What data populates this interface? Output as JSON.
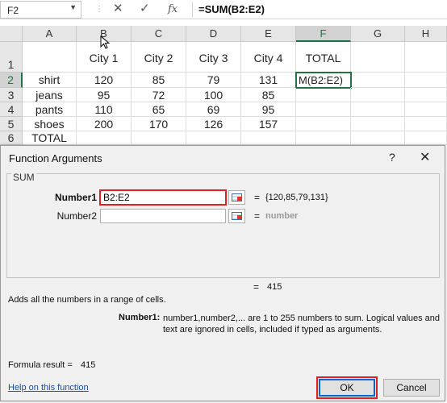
{
  "formula_bar": {
    "name_box": "F2",
    "formula": "=SUM(B2:E2)",
    "cancel_icon": "x-icon",
    "enter_icon": "check-icon",
    "fx_label": "fx"
  },
  "sheet": {
    "columns": [
      "A",
      "B",
      "C",
      "D",
      "E",
      "F",
      "G",
      "H"
    ],
    "rows": [
      "1",
      "2",
      "3",
      "4",
      "5",
      "6"
    ],
    "cells": {
      "B1": "City 1",
      "C1": "City 2",
      "D1": "City 3",
      "E1": "City 4",
      "F1": "TOTAL",
      "A2": "shirt",
      "B2": "120",
      "C2": "85",
      "D2": "79",
      "E2": "131",
      "F2": "M(B2:E2)",
      "A3": "jeans",
      "B3": "95",
      "C3": "72",
      "D3": "100",
      "E3": "85",
      "A4": "pants",
      "B4": "110",
      "C4": "65",
      "D4": "69",
      "E4": "95",
      "A5": "shoes",
      "B5": "200",
      "C5": "170",
      "D5": "126",
      "E5": "157",
      "A6": "TOTAL"
    }
  },
  "dialog": {
    "title": "Function Arguments",
    "help_glyph": "?",
    "close_glyph": "✕",
    "function_name": "SUM",
    "args": [
      {
        "label": "Number1",
        "value": "B2:E2",
        "result": "{120,85,79,131}"
      },
      {
        "label": "Number2",
        "value": "",
        "result": "number"
      }
    ],
    "eq": "=",
    "total_result": "415",
    "description": "Adds all the numbers in a range of cells.",
    "arg_desc_name": "Number1:",
    "arg_desc_text": "number1,number2,... are 1 to 255 numbers to sum. Logical values and text are ignored in cells, included if typed as arguments.",
    "formula_result_label": "Formula result =",
    "formula_result_value": "415",
    "help_link": "Help on this function",
    "ok_label": "OK",
    "cancel_label": "Cancel"
  }
}
